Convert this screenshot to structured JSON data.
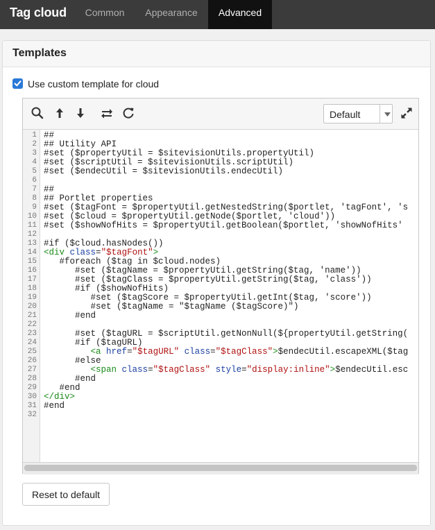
{
  "app": {
    "title": "Tag cloud"
  },
  "tabs": [
    {
      "label": "Common",
      "active": false
    },
    {
      "label": "Appearance",
      "active": false
    },
    {
      "label": "Advanced",
      "active": true
    }
  ],
  "panel": {
    "title": "Templates",
    "checkbox_label": "Use custom template for cloud",
    "checkbox_checked": true
  },
  "editor": {
    "toolbar_icons": [
      "search-icon",
      "arrow-up-icon",
      "arrow-down-icon",
      "swap-icon",
      "refresh-icon"
    ],
    "theme_select_value": "Default",
    "expand_icon": "expand-icon",
    "lines": [
      "##",
      "## Utility API",
      "#set ($propertyUtil = $sitevisionUtils.propertyUtil)",
      "#set ($scriptUtil = $sitevisionUtils.scriptUtil)",
      "#set ($endecUtil = $sitevisionUtils.endecUtil)",
      "",
      "##",
      "## Portlet properties",
      "#set ($tagFont = $propertyUtil.getNestedString($portlet, 'tagFont', 's",
      "#set ($cloud = $propertyUtil.getNode($portlet, 'cloud'))",
      "#set ($showNofHits = $propertyUtil.getBoolean($portlet, 'showNofHits'",
      "",
      "#if ($cloud.hasNodes())",
      "<div class=\"$tagFont\">",
      "   #foreach ($tag in $cloud.nodes)",
      "      #set ($tagName = $propertyUtil.getString($tag, 'name'))",
      "      #set ($tagClass = $propertyUtil.getString($tag, 'class'))",
      "      #if ($showNofHits)",
      "         #set ($tagScore = $propertyUtil.getInt($tag, 'score'))",
      "         #set ($tagName = \"$tagName ($tagScore)\")",
      "      #end",
      "",
      "      #set ($tagURL = $scriptUtil.getNonNull(${propertyUtil.getString(",
      "      #if ($tagURL)",
      "         <a href=\"$tagURL\" class=\"$tagClass\">$endecUtil.escapeXML($tag",
      "      #else",
      "         <span class=\"$tagClass\" style=\"display:inline\">$endecUtil.esc",
      "      #end",
      "   #end",
      "</div>",
      "#end",
      ""
    ]
  },
  "buttons": {
    "reset_label": "Reset to default"
  },
  "colors": {
    "topbar": "#3b3b3b",
    "active_tab": "#111111",
    "checkbox": "#2a79d7",
    "html_tag": "#1a8a1a",
    "html_attr": "#1a3fa0",
    "html_string": "#b01010"
  }
}
